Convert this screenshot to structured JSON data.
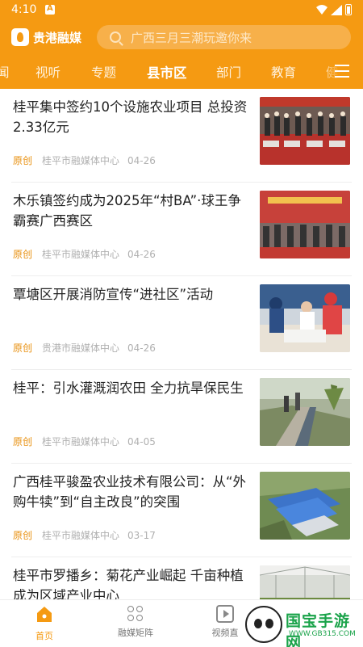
{
  "status_bar": {
    "time": "4:10"
  },
  "app": {
    "name": "贵港融媒"
  },
  "search": {
    "placeholder": "广西三月三潮玩邀你来"
  },
  "tabs": [
    {
      "label": "闻"
    },
    {
      "label": "视听"
    },
    {
      "label": "专题"
    },
    {
      "label": "县市区"
    },
    {
      "label": "部门"
    },
    {
      "label": "教育"
    },
    {
      "label": "健"
    }
  ],
  "active_tab": "县市区",
  "articles": [
    {
      "title": "桂平集中签约10个设施农业项目 总投资2.33亿元",
      "tag": "原创",
      "source": "桂平市融媒体中心",
      "date": "04-26",
      "thumb": "signing-ceremony-photo"
    },
    {
      "title": "木乐镇签约成为2025年“村BA”·球王争霸赛广西赛区",
      "tag": "原创",
      "source": "桂平市融媒体中心",
      "date": "04-26",
      "thumb": "signing-stage-photo"
    },
    {
      "title": "覃塘区开展消防宣传“进社区”活动",
      "tag": "原创",
      "source": "贵港市融媒体中心",
      "date": "04-26",
      "thumb": "fire-safety-event-photo"
    },
    {
      "title": "桂平：引水灌溉润农田 全力抗旱保民生",
      "tag": "原创",
      "source": "桂平市融媒体中心",
      "date": "04-05",
      "thumb": "irrigation-channel-photo"
    },
    {
      "title": "广西桂平骏盈农业技术有限公司：从“外购牛犊”到“自主改良”的突围",
      "tag": "原创",
      "source": "桂平市融媒体中心",
      "date": "03-17",
      "thumb": "farm-aerial-photo"
    },
    {
      "title": "桂平市罗播乡：菊花产业崛起 千亩种植成为区域产业中心",
      "tag": "",
      "source": "",
      "date": "",
      "thumb": "chrysanthemum-greenhouse-photo"
    }
  ],
  "bottom_nav": [
    {
      "label": "首页",
      "icon": "home-icon"
    },
    {
      "label": "融媒矩阵",
      "icon": "grid-icon"
    },
    {
      "label": "视频直",
      "icon": "video-icon"
    }
  ],
  "watermark": {
    "title": "国宝手游网",
    "url": "WWW.GB315.COM"
  },
  "colors": {
    "brand": "#f59a12",
    "tag": "#e89010",
    "watermark": "#1aa34a"
  }
}
